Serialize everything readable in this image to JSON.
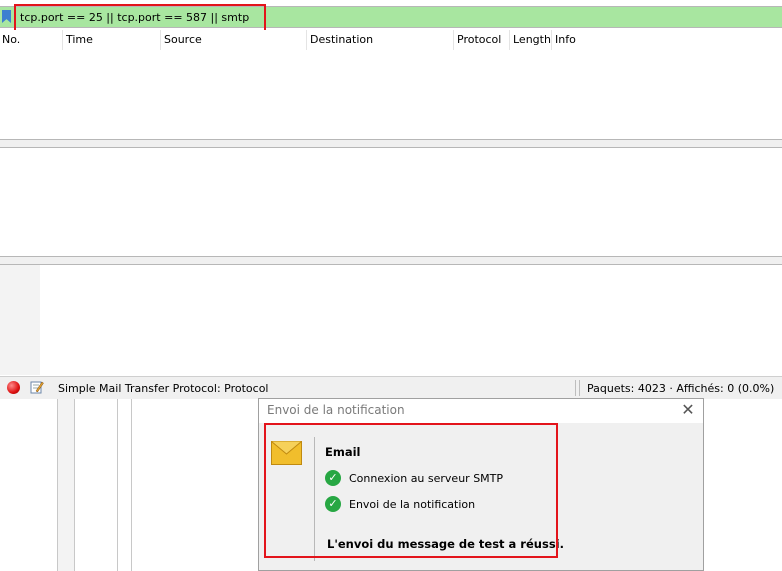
{
  "filter": {
    "value": "tcp.port == 25 || tcp.port == 587 || smtp"
  },
  "packet_list": {
    "columns": [
      "No.",
      "Time",
      "Source",
      "Destination",
      "Protocol",
      "Length",
      "Info"
    ]
  },
  "status_bar": {
    "field_info": "Simple Mail Transfer Protocol: Protocol",
    "packet_stats": "Paquets: 4023 · Affichés: 0 (0.0%)"
  },
  "dialog": {
    "title": "Envoi de la notification",
    "heading": "Email",
    "steps": [
      {
        "label": "Connexion au serveur SMTP",
        "icon": "check-circle-icon",
        "status_color": "#27a743"
      },
      {
        "label": "Envoi de la notification",
        "icon": "check-circle-icon",
        "status_color": "#27a743"
      }
    ],
    "result": "L'envoi du message de test a réussi."
  },
  "colors": {
    "filter_valid": "#a8e6a0",
    "highlight": "#e3141b",
    "success": "#27a743"
  }
}
